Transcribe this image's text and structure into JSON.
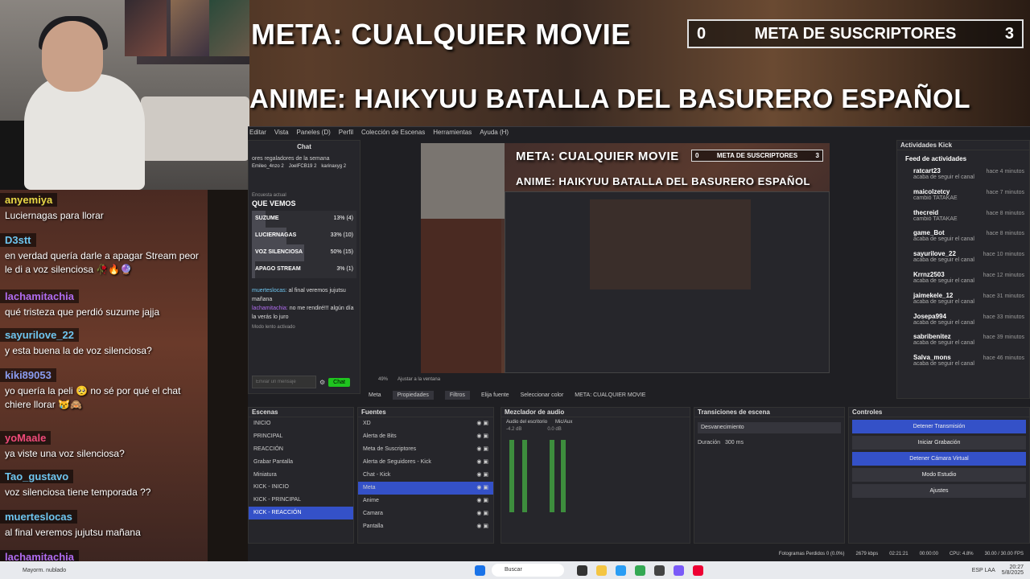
{
  "overlay": {
    "meta_title": "META: CUALQUIER MOVIE",
    "anime_title": "ANIME: HAIKYUU BATALLA DEL BASURERO ESPAÑOL",
    "subs_goal": {
      "left": "0",
      "label": "META DE SUSCRIPTORES",
      "right": "3"
    }
  },
  "chat_overlay": [
    {
      "user": "anyemiya",
      "color": "#e8d846",
      "text": "Luciernagas para llorar"
    },
    {
      "user": "D3stt",
      "color": "#6ec6f0",
      "text": "en verdad quería darle a apagar Stream peor le di a voz silenciosa 🥀🔥🔮"
    },
    {
      "user": "lachamitachia",
      "color": "#b06cf0",
      "text": "qué tristeza que perdió suzume jajja"
    },
    {
      "user": "sayurilove_22",
      "color": "#6ec6f0",
      "text": "y esta buena la de voz silenciosa?"
    },
    {
      "user": "kiki89053",
      "color": "#8a9cf0",
      "text": "yo quería la peli 🥺 no sé por qué el chat chiere llorar 😿🙈"
    },
    {
      "user": "yoMaale",
      "color": "#f04a7a",
      "text": "ya viste una voz silenciosa?"
    },
    {
      "user": "Tao_gustavo",
      "color": "#6ec6f0",
      "text": "voz silenciosa tiene temporada ??"
    },
    {
      "user": "muerteslocas",
      "color": "#6ec6f0",
      "text": "al final veremos jujutsu mañana"
    },
    {
      "user": "lachamitachia",
      "color": "#b06cf0",
      "text": "no me rendiré!!! algún día la verás lo juro"
    }
  ],
  "obs": {
    "menu": [
      "Editar",
      "Vista",
      "Paneles (D)",
      "Perfil",
      "Colección de Escenas",
      "Herramientas",
      "Ayuda (H)"
    ],
    "chat_panel": {
      "title": "Chat",
      "gifters_title": "ores regaladores de la semana",
      "gifters": [
        {
          "name": "Emileo_4nzo",
          "n": "2"
        },
        {
          "name": "JoelFCB19",
          "n": "2"
        },
        {
          "name": "karinaxyg",
          "n": "2"
        }
      ],
      "poll_label": "Encuesta actual",
      "poll_title": "QUE VEMOS",
      "poll": [
        {
          "opt": "SUZUME",
          "res": "13% (4)",
          "pct": 13
        },
        {
          "opt": "LUCIERNAGAS",
          "res": "33% (10)",
          "pct": 33
        },
        {
          "opt": "VOZ SILENCIOSA",
          "res": "50% (15)",
          "pct": 50
        },
        {
          "opt": "APAGO STREAM",
          "res": "3% (1)",
          "pct": 3
        }
      ],
      "msg1_user": "muerteslocas:",
      "msg1": "al final veremos jujutsu mañana",
      "msg2_user": "lachamitachia:",
      "msg2": "no me rendiré!!! algún día la verás lo juro",
      "slow_mode": "Modo lento activado",
      "input_placeholder": "Enviar un mensaje",
      "send": "Chat"
    },
    "preview_footer": {
      "zoom": "49%",
      "fit": "Ajustar a la ventana"
    },
    "props_bar": {
      "scene": "Meta",
      "props": "Propiedades",
      "filters": "Filtros",
      "source": "Elija fuente",
      "color": "Seleccionar color",
      "text": "META: CUALQUIER MOVIE"
    },
    "scenes": {
      "title": "Escenas",
      "items": [
        "INICIO",
        "PRINCIPAL",
        "REACCIÓN",
        "Grabar Pantalla",
        "Miniatura",
        "KICK - INICIO",
        "KICK - PRINCIPAL",
        "KICK - REACCIÓN"
      ],
      "selected": 7
    },
    "sources": {
      "title": "Fuentes",
      "items": [
        "XD",
        "Alerta de Bits",
        "Meta de Suscriptores",
        "Alerta de Seguidores - Kick",
        "Chat - Kick",
        "Meta",
        "Anime",
        "Camara",
        "Pantalla"
      ],
      "selected": 5
    },
    "mixer": {
      "title": "Mezclador de audio",
      "ch1": "Audio del escritorio",
      "ch1_db": "-4.2 dB",
      "ch2": "Mic/Aux",
      "ch2_db": "0.0 dB",
      "scale": [
        "-5",
        "-10",
        "-15",
        "-20",
        "-25",
        "-30",
        "-35",
        "-40",
        "-45",
        "-50",
        "-55",
        "-60"
      ]
    },
    "transitions": {
      "title": "Transiciones de escena",
      "type": "Desvanecimiento",
      "duration_label": "Duración",
      "duration": "300 ms"
    },
    "controls": {
      "title": "Controles",
      "buttons": [
        {
          "label": "Detener Transmisión",
          "active": true
        },
        {
          "label": "Iniciar Grabación",
          "active": false
        },
        {
          "label": "Detener Cámara Virtual",
          "active": true
        },
        {
          "label": "Modo Estudio",
          "active": false
        },
        {
          "label": "Ajustes",
          "active": false
        }
      ]
    },
    "kick_activity": {
      "title": "Actividades Kick",
      "feed_title": "Feed de actividades",
      "items": [
        {
          "user": "ratcart23",
          "sub": "acaba de seguir el canal",
          "time": "hace 4 minutos"
        },
        {
          "user": "maicolzetcy",
          "sub": "cambió TATAKAE",
          "time": "hace 7 minutos"
        },
        {
          "user": "thecreid",
          "sub": "cambió TATAKAE",
          "time": "hace 8 minutos"
        },
        {
          "user": "game_Bot",
          "sub": "acaba de seguir el canal",
          "time": "hace 8 minutos"
        },
        {
          "user": "sayurilove_22",
          "sub": "acaba de seguir el canal",
          "time": "hace 10 minutos"
        },
        {
          "user": "Krrnz2503",
          "sub": "acaba de seguir el canal",
          "time": "hace 12 minutos"
        },
        {
          "user": "jaimekele_12",
          "sub": "acaba de seguir el canal",
          "time": "hace 31 minutos"
        },
        {
          "user": "Josepa994",
          "sub": "acaba de seguir el canal",
          "time": "hace 33 minutos"
        },
        {
          "user": "sabribenitez",
          "sub": "acaba de seguir el canal",
          "time": "hace 39 minutos"
        },
        {
          "user": "Salva_mons",
          "sub": "acaba de seguir el canal",
          "time": "hace 46 minutos"
        }
      ]
    },
    "status": {
      "dropped": "Fotogramas Perdidos 0 (0.0%)",
      "kbps": "2679 kbps",
      "live": "02:21:21",
      "rec": "00:00:00",
      "cpu": "CPU: 4.8%",
      "fps": "30.00 / 30.00 FPS"
    }
  },
  "taskbar": {
    "weather": "Mayorm. nublado",
    "search": "Buscar",
    "lang": "ESP LAA",
    "time": "20:27",
    "date": "5/8/2025"
  }
}
